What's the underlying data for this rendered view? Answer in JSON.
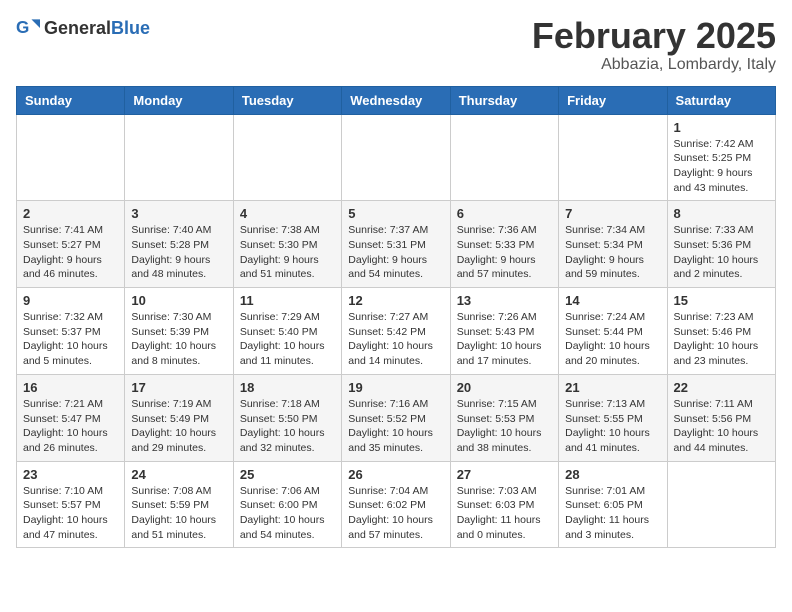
{
  "header": {
    "logo_general": "General",
    "logo_blue": "Blue",
    "month": "February 2025",
    "location": "Abbazia, Lombardy, Italy"
  },
  "weekdays": [
    "Sunday",
    "Monday",
    "Tuesday",
    "Wednesday",
    "Thursday",
    "Friday",
    "Saturday"
  ],
  "weeks": [
    [
      {
        "day": "",
        "info": ""
      },
      {
        "day": "",
        "info": ""
      },
      {
        "day": "",
        "info": ""
      },
      {
        "day": "",
        "info": ""
      },
      {
        "day": "",
        "info": ""
      },
      {
        "day": "",
        "info": ""
      },
      {
        "day": "1",
        "info": "Sunrise: 7:42 AM\nSunset: 5:25 PM\nDaylight: 9 hours and 43 minutes."
      }
    ],
    [
      {
        "day": "2",
        "info": "Sunrise: 7:41 AM\nSunset: 5:27 PM\nDaylight: 9 hours and 46 minutes."
      },
      {
        "day": "3",
        "info": "Sunrise: 7:40 AM\nSunset: 5:28 PM\nDaylight: 9 hours and 48 minutes."
      },
      {
        "day": "4",
        "info": "Sunrise: 7:38 AM\nSunset: 5:30 PM\nDaylight: 9 hours and 51 minutes."
      },
      {
        "day": "5",
        "info": "Sunrise: 7:37 AM\nSunset: 5:31 PM\nDaylight: 9 hours and 54 minutes."
      },
      {
        "day": "6",
        "info": "Sunrise: 7:36 AM\nSunset: 5:33 PM\nDaylight: 9 hours and 57 minutes."
      },
      {
        "day": "7",
        "info": "Sunrise: 7:34 AM\nSunset: 5:34 PM\nDaylight: 9 hours and 59 minutes."
      },
      {
        "day": "8",
        "info": "Sunrise: 7:33 AM\nSunset: 5:36 PM\nDaylight: 10 hours and 2 minutes."
      }
    ],
    [
      {
        "day": "9",
        "info": "Sunrise: 7:32 AM\nSunset: 5:37 PM\nDaylight: 10 hours and 5 minutes."
      },
      {
        "day": "10",
        "info": "Sunrise: 7:30 AM\nSunset: 5:39 PM\nDaylight: 10 hours and 8 minutes."
      },
      {
        "day": "11",
        "info": "Sunrise: 7:29 AM\nSunset: 5:40 PM\nDaylight: 10 hours and 11 minutes."
      },
      {
        "day": "12",
        "info": "Sunrise: 7:27 AM\nSunset: 5:42 PM\nDaylight: 10 hours and 14 minutes."
      },
      {
        "day": "13",
        "info": "Sunrise: 7:26 AM\nSunset: 5:43 PM\nDaylight: 10 hours and 17 minutes."
      },
      {
        "day": "14",
        "info": "Sunrise: 7:24 AM\nSunset: 5:44 PM\nDaylight: 10 hours and 20 minutes."
      },
      {
        "day": "15",
        "info": "Sunrise: 7:23 AM\nSunset: 5:46 PM\nDaylight: 10 hours and 23 minutes."
      }
    ],
    [
      {
        "day": "16",
        "info": "Sunrise: 7:21 AM\nSunset: 5:47 PM\nDaylight: 10 hours and 26 minutes."
      },
      {
        "day": "17",
        "info": "Sunrise: 7:19 AM\nSunset: 5:49 PM\nDaylight: 10 hours and 29 minutes."
      },
      {
        "day": "18",
        "info": "Sunrise: 7:18 AM\nSunset: 5:50 PM\nDaylight: 10 hours and 32 minutes."
      },
      {
        "day": "19",
        "info": "Sunrise: 7:16 AM\nSunset: 5:52 PM\nDaylight: 10 hours and 35 minutes."
      },
      {
        "day": "20",
        "info": "Sunrise: 7:15 AM\nSunset: 5:53 PM\nDaylight: 10 hours and 38 minutes."
      },
      {
        "day": "21",
        "info": "Sunrise: 7:13 AM\nSunset: 5:55 PM\nDaylight: 10 hours and 41 minutes."
      },
      {
        "day": "22",
        "info": "Sunrise: 7:11 AM\nSunset: 5:56 PM\nDaylight: 10 hours and 44 minutes."
      }
    ],
    [
      {
        "day": "23",
        "info": "Sunrise: 7:10 AM\nSunset: 5:57 PM\nDaylight: 10 hours and 47 minutes."
      },
      {
        "day": "24",
        "info": "Sunrise: 7:08 AM\nSunset: 5:59 PM\nDaylight: 10 hours and 51 minutes."
      },
      {
        "day": "25",
        "info": "Sunrise: 7:06 AM\nSunset: 6:00 PM\nDaylight: 10 hours and 54 minutes."
      },
      {
        "day": "26",
        "info": "Sunrise: 7:04 AM\nSunset: 6:02 PM\nDaylight: 10 hours and 57 minutes."
      },
      {
        "day": "27",
        "info": "Sunrise: 7:03 AM\nSunset: 6:03 PM\nDaylight: 11 hours and 0 minutes."
      },
      {
        "day": "28",
        "info": "Sunrise: 7:01 AM\nSunset: 6:05 PM\nDaylight: 11 hours and 3 minutes."
      },
      {
        "day": "",
        "info": ""
      }
    ]
  ]
}
